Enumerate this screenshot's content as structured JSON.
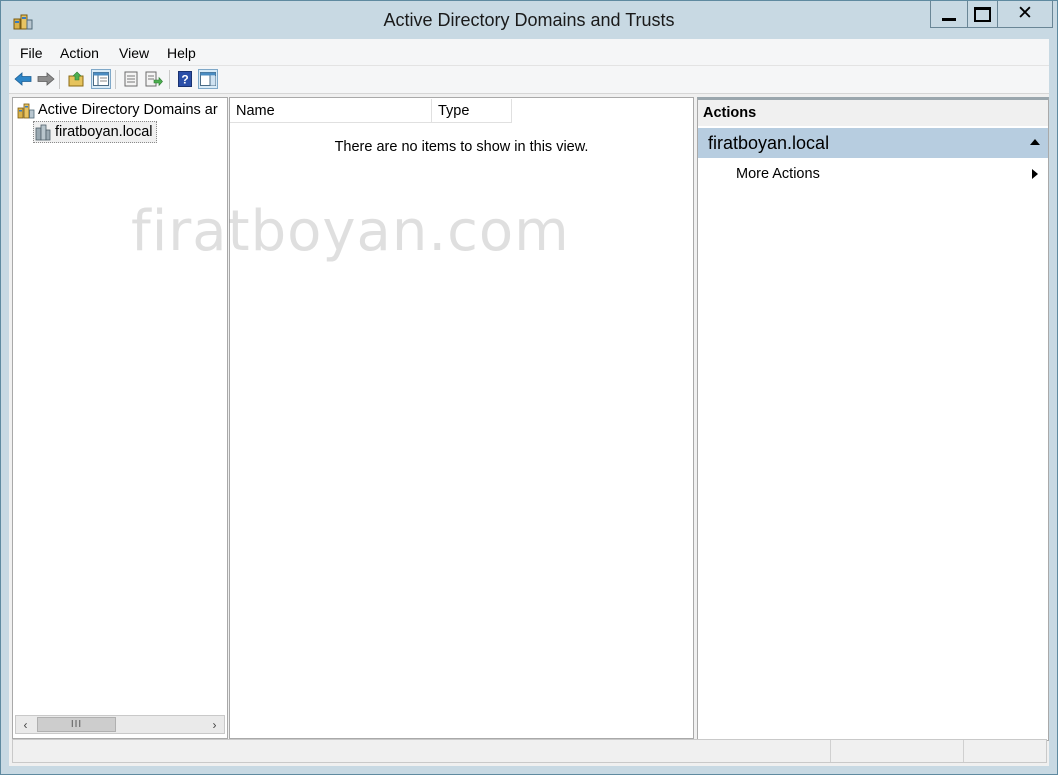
{
  "window": {
    "title": "Active Directory Domains and Trusts",
    "controls": [
      "minimize",
      "maximize",
      "close"
    ]
  },
  "menubar": {
    "items": [
      {
        "label": "File"
      },
      {
        "label": "Action"
      },
      {
        "label": "View"
      },
      {
        "label": "Help"
      }
    ]
  },
  "toolbar": {
    "buttons": [
      {
        "icon": "back-arrow-icon"
      },
      {
        "icon": "forward-arrow-icon"
      },
      {
        "icon": "up-folder-icon"
      },
      {
        "icon": "show-hide-console-tree-icon"
      },
      {
        "icon": "properties-icon"
      },
      {
        "icon": "export-list-icon"
      },
      {
        "icon": "help-icon"
      },
      {
        "icon": "show-hide-action-pane-icon"
      }
    ]
  },
  "tree": {
    "root_label": "Active Directory Domains ar",
    "child_label": "firatboyan.local"
  },
  "list": {
    "columns": [
      "Name",
      "Type"
    ],
    "empty_message": "There are no items to show in this view."
  },
  "actions": {
    "header": "Actions",
    "section_title": "firatboyan.local",
    "items": [
      "More Actions"
    ]
  },
  "watermark": "firatboyan.com",
  "colors": {
    "frame": "#c8d9e3",
    "actions_section_bg": "#b7cde0",
    "back_forward_arrow": "#2e86c8"
  }
}
